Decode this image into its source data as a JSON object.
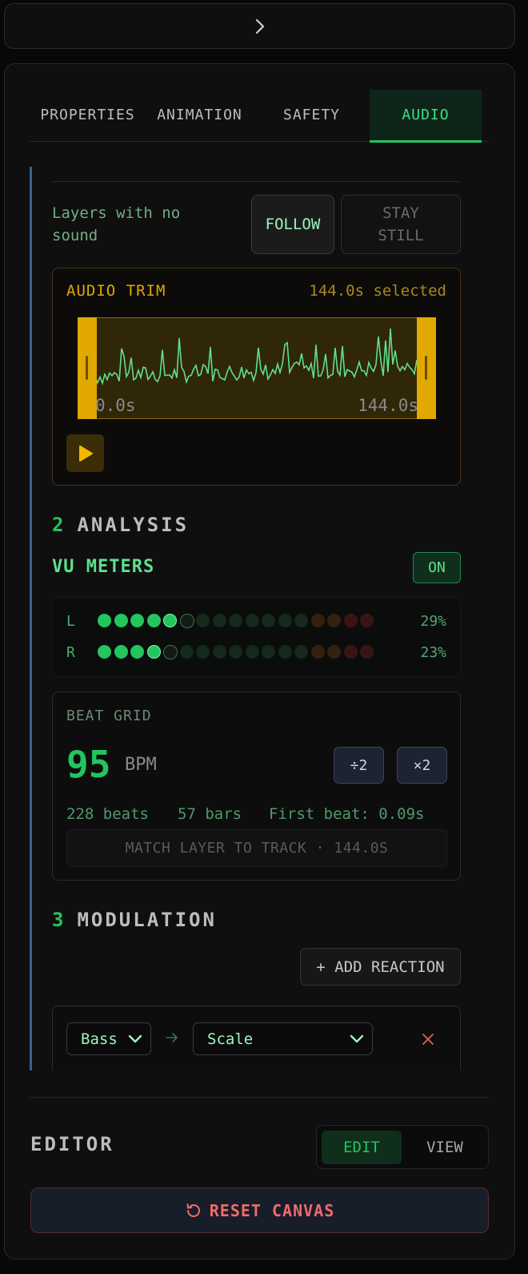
{
  "topbar": {
    "chevron": "chevron-right-icon"
  },
  "tabs": [
    {
      "label": "PROPERTIES"
    },
    {
      "label": "ANIMATION"
    },
    {
      "label": "SAFETY"
    },
    {
      "label": "AUDIO",
      "active": true
    }
  ],
  "no_sound": {
    "label": "Layers with no sound",
    "options": [
      "FOLLOW",
      "STAY STILL"
    ],
    "selected": "FOLLOW"
  },
  "audio_trim": {
    "title": "AUDIO TRIM",
    "selected_text": "144.0s selected",
    "start_label": "0.0s",
    "end_label": "144.0s",
    "play_icon": "play-icon"
  },
  "analysis": {
    "number": "2",
    "title": "ANALYSIS",
    "vu_title": "VU METERS",
    "vu_toggle": "ON",
    "meters": [
      {
        "channel": "L",
        "percent": "29%",
        "level": 5
      },
      {
        "channel": "R",
        "percent": "23%",
        "level": 4
      }
    ],
    "segments": 17
  },
  "beat_grid": {
    "title": "BEAT GRID",
    "bpm": "95",
    "bpm_unit": "BPM",
    "half_label": "÷2",
    "double_label": "×2",
    "beats": "228 beats",
    "bars": "57 bars",
    "first_beat": "First beat: 0.09s",
    "match_button": "MATCH LAYER TO TRACK · 144.0S"
  },
  "modulation": {
    "number": "3",
    "title": "MODULATION",
    "add_button": "+ ADD REACTION",
    "reactions": [
      {
        "source": "Bass",
        "target": "Scale"
      }
    ]
  },
  "editor": {
    "label": "EDITOR",
    "modes": [
      "EDIT",
      "VIEW"
    ],
    "active_mode": "EDIT",
    "reset_label": "RESET CANVAS"
  },
  "colors": {
    "accent": "#22c55e",
    "trim": "#e0a800",
    "danger": "#f06b6b"
  }
}
